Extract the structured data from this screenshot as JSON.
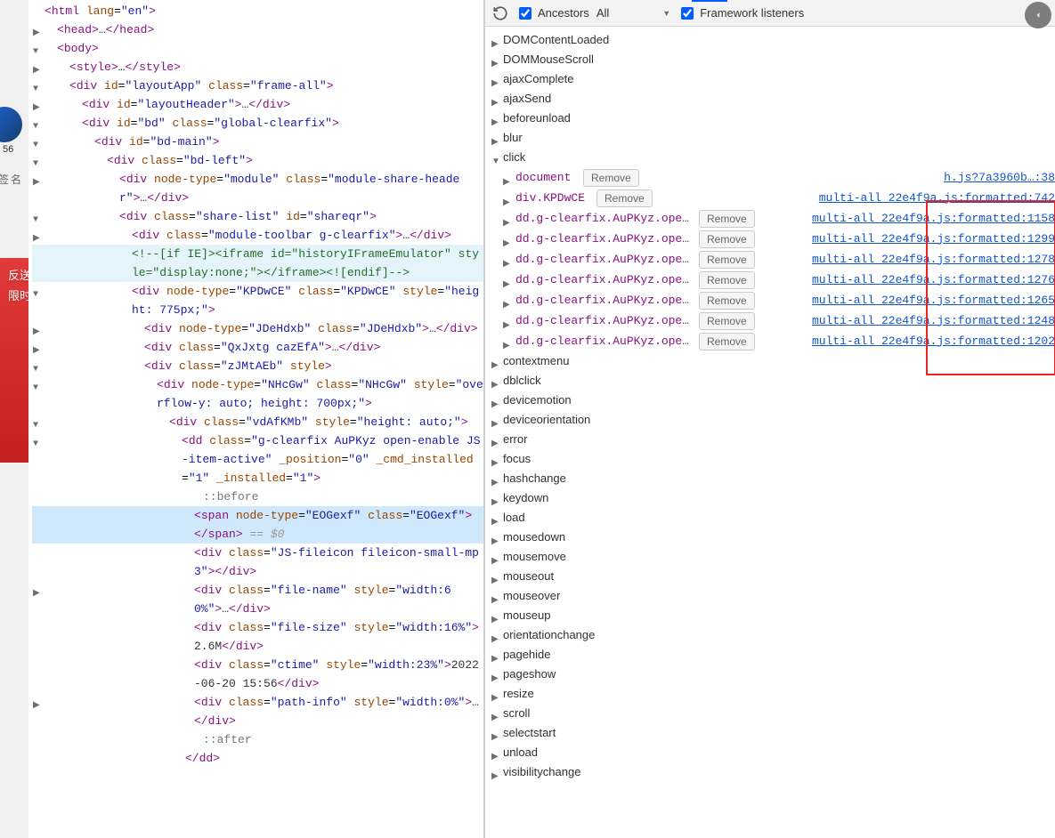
{
  "left_strip": {
    "number": "56",
    "signature": "签名",
    "banner": "反送\n限时"
  },
  "toolbar": {
    "ancestors_label": "Ancestors",
    "scope": "All",
    "framework_label": "Framework listeners"
  },
  "events_top": [
    "DOMContentLoaded",
    "DOMMouseScroll",
    "ajaxComplete",
    "ajaxSend",
    "beforeunload",
    "blur"
  ],
  "click": {
    "label": "click",
    "handlers": [
      {
        "target": "document",
        "link": "h.js?7a3960b…:38",
        "sep": " "
      },
      {
        "target": "div.KPDwCE",
        "link": "multi-all_22e4f9a.js:formatted:742",
        "sep": " "
      },
      {
        "target": "dd.g-clearfix.AuPKyz.open-e…",
        "link": "multi-all_22e4f9a.js:formatted:1158"
      },
      {
        "target": "dd.g-clearfix.AuPKyz.open-e…",
        "link": "multi-all_22e4f9a.js:formatted:1299"
      },
      {
        "target": "dd.g-clearfix.AuPKyz.open-e…",
        "link": "multi-all_22e4f9a.js:formatted:1278"
      },
      {
        "target": "dd.g-clearfix.AuPKyz.open-e…",
        "link": "multi-all_22e4f9a.js:formatted:1276"
      },
      {
        "target": "dd.g-clearfix.AuPKyz.open-e…",
        "link": "multi-all_22e4f9a.js:formatted:1265"
      },
      {
        "target": "dd.g-clearfix.AuPKyz.open-e…",
        "link": "multi-all_22e4f9a.js:formatted:1248"
      },
      {
        "target": "dd.g-clearfix.AuPKyz.open-e…",
        "link": "multi-all_22e4f9a.js:formatted:1202"
      }
    ],
    "remove_label": "Remove"
  },
  "events_bottom": [
    "contextmenu",
    "dblclick",
    "devicemotion",
    "deviceorientation",
    "error",
    "focus",
    "hashchange",
    "keydown",
    "load",
    "mousedown",
    "mousemove",
    "mouseout",
    "mouseover",
    "mouseup",
    "orientationchange",
    "pagehide",
    "pageshow",
    "resize",
    "scroll",
    "selectstart",
    "unload",
    "visibilitychange"
  ],
  "dom": {
    "text": {
      "size": "2.6M",
      "date": "2022-06-20 15:56",
      "span_ghost": " == $0",
      "before": "::before",
      "after": "::after"
    }
  }
}
